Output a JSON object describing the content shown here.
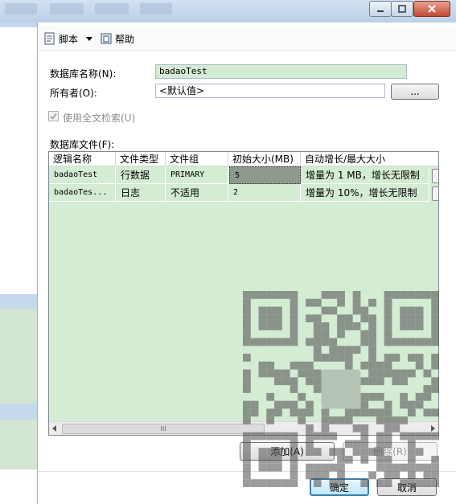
{
  "toolbar": {
    "script_label": "脚本",
    "help_label": "帮助"
  },
  "form": {
    "dbname_label": "数据库名称(N):",
    "dbname_value": "badaoTest",
    "owner_label": "所有者(O):",
    "owner_value": "<默认值>",
    "owner_browse_label": "...",
    "fulltext_label": "使用全文检索(U)",
    "fulltext_checked": true,
    "files_label": "数据库文件(F):"
  },
  "grid": {
    "columns": [
      "逻辑名称",
      "文件类型",
      "文件组",
      "初始大小(MB)",
      "自动增长/最大大小"
    ],
    "rows": [
      [
        "badaoTest",
        "行数据",
        "PRIMARY",
        "5",
        "增量为 1 MB，增长无限制"
      ],
      [
        "badaoTes...",
        "日志",
        "不适用",
        "2",
        "增量为 10%，增长无限制"
      ]
    ],
    "hscroll_grip": "III"
  },
  "actions": {
    "add_label": "添加(A)",
    "remove_label": "删除(R)",
    "ok_label": "确定",
    "cancel_label": "取消"
  },
  "colors": {
    "grid_bg": "#d4ebd4",
    "selected_cell": "#8f9a8f",
    "highlight_field": "#d4ebd4"
  }
}
